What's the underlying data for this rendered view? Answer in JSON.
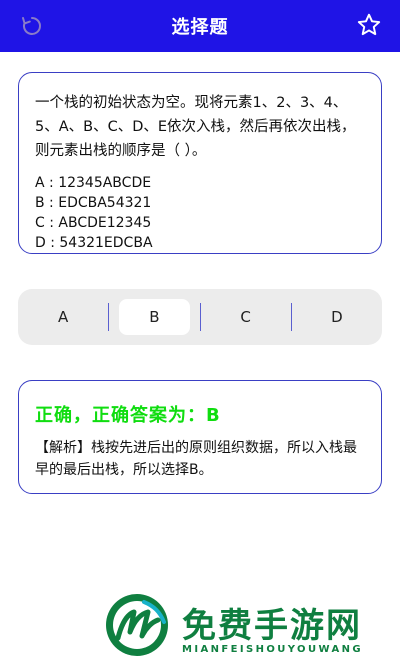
{
  "header": {
    "title": "选择题",
    "back_icon": "refresh-back-icon",
    "favorite_icon": "star-icon"
  },
  "question": {
    "text": "一个栈的初始状态为空。现将元素1、2、3、4、5、A、B、C、D、E依次入栈，然后再依次出栈，则元素出栈的顺序是（ ）。",
    "options": [
      "A : 12345ABCDE",
      "B : EDCBA54321",
      "C : ABCDE12345",
      "D : 54321EDCBA"
    ]
  },
  "choices": {
    "labels": [
      "A",
      "B",
      "C",
      "D"
    ],
    "selected": "B"
  },
  "result": {
    "title": "正确，正确答案为：B",
    "analysis": "【解析】栈按先进后出的原则组织数据，所以入栈最早的最后出栈，所以选择B。"
  },
  "watermark": {
    "text": "免费手游网",
    "subtext": "MIANFEISHOUYOUWANG"
  },
  "colors": {
    "header": "#1f14e6",
    "border": "#3a3fc4",
    "correct": "#10dd10",
    "watermark": "#0f7f40"
  }
}
